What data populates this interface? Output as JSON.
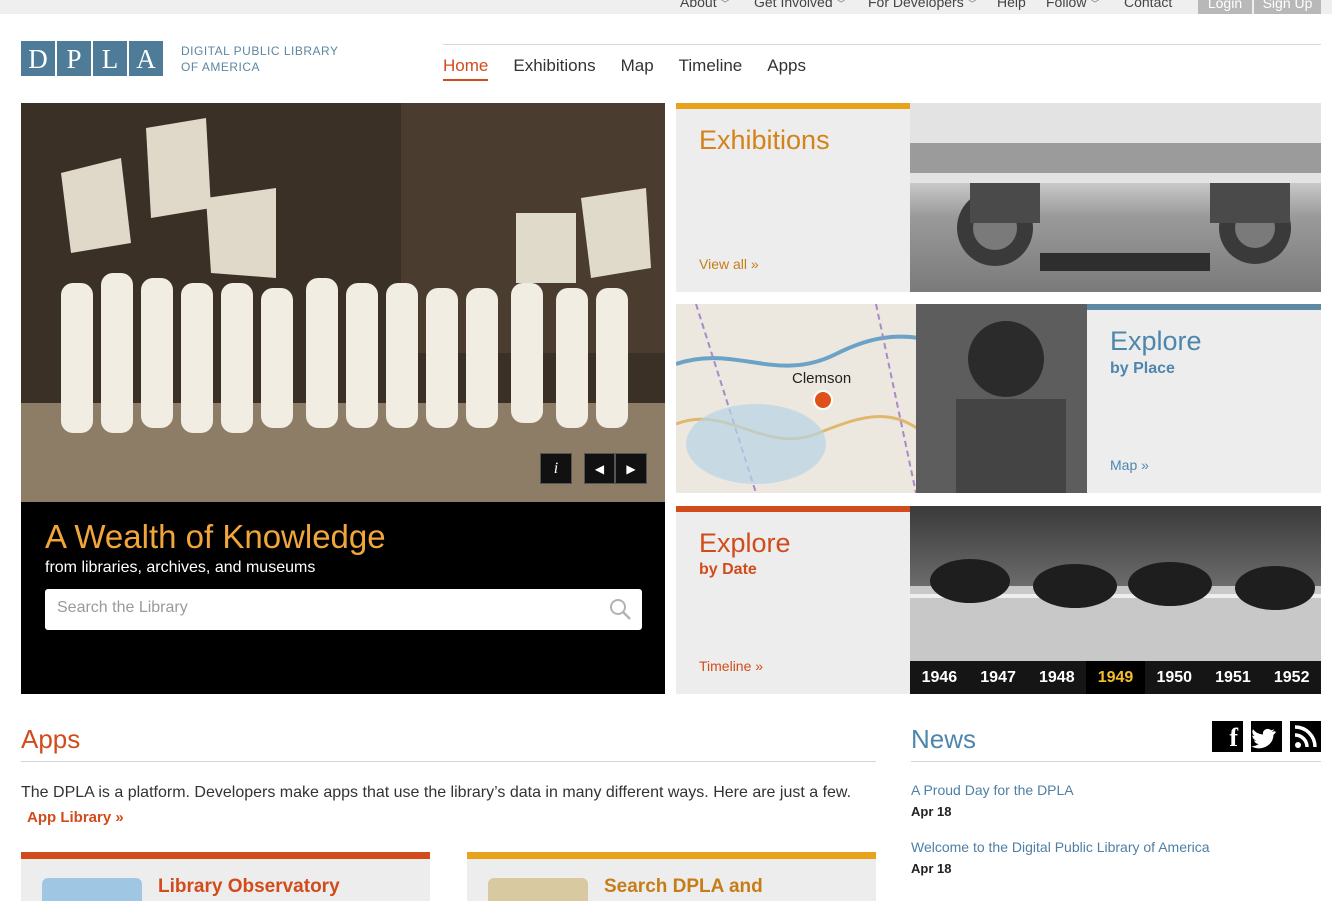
{
  "utility_nav": [
    {
      "label": "About"
    },
    {
      "label": "Get Involved"
    },
    {
      "label": "For Developers"
    },
    {
      "label": "Help"
    },
    {
      "label": "Follow"
    },
    {
      "label": "Contact"
    }
  ],
  "auth": {
    "login": "Login",
    "signup": "Sign Up"
  },
  "logo": {
    "letters": [
      "D",
      "P",
      "L",
      "A"
    ],
    "line1": "DIGITAL PUBLIC LIBRARY",
    "line2": "OF AMERICA"
  },
  "main_nav": [
    {
      "label": "Home",
      "active": true
    },
    {
      "label": "Exhibitions"
    },
    {
      "label": "Map"
    },
    {
      "label": "Timeline"
    },
    {
      "label": "Apps"
    }
  ],
  "hero": {
    "title": "A Wealth of Knowledge",
    "subtitle": "from libraries, archives, and museums",
    "search_placeholder": "Search the Library",
    "info": "i",
    "prev": "◀",
    "next": "▶"
  },
  "tiles": {
    "exhibitions": {
      "title": "Exhibitions",
      "link": "View all »"
    },
    "place": {
      "title": "Explore",
      "sub": "by Place",
      "link": "Map »",
      "map_label": "Clemson"
    },
    "date": {
      "title": "Explore",
      "sub": "by Date",
      "link": "Timeline »",
      "years": [
        "1946",
        "1947",
        "1948",
        "1949",
        "1950",
        "1951",
        "1952"
      ],
      "selected_year": "1949"
    }
  },
  "apps": {
    "title": "Apps",
    "text": "The DPLA is a platform. Developers make apps that use the library’s data in many different ways. Here are just a few.",
    "library_link": "App Library »",
    "cards": [
      {
        "title": "Library Observatory",
        "bar_color": "#d24c1b"
      },
      {
        "title": "Search DPLA and",
        "bar_color": "#e8a21c"
      }
    ]
  },
  "news": {
    "title": "News",
    "social": [
      {
        "icon": "facebook-icon",
        "glyph": "f"
      },
      {
        "icon": "twitter-icon",
        "glyph": "t"
      },
      {
        "icon": "rss-icon",
        "glyph": ")"
      }
    ],
    "items": [
      {
        "title": "A Proud Day for the DPLA",
        "date": "Apr 18"
      },
      {
        "title": "Welcome to the Digital Public Library of America",
        "date": "Apr 18"
      }
    ]
  },
  "colors": {
    "orange": "#d24c1b",
    "gold": "#e8a21c",
    "blue": "#4e7b98",
    "steel": "#5f8aa6"
  }
}
